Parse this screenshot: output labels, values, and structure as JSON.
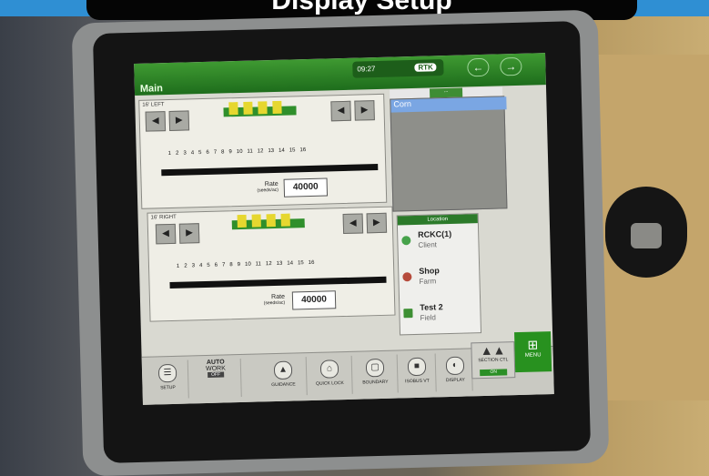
{
  "banner": {
    "title": "Display Setup"
  },
  "topbar": {
    "title": "Main",
    "time": "09:27",
    "rtk": "RTK",
    "back_label": "←",
    "forward_label": "→"
  },
  "panels": {
    "left_top": {
      "tag": "16' LEFT",
      "rate_label": "Rate",
      "rate_unit": "(seeds/ac)",
      "rate_value": "40000"
    },
    "left_bottom": {
      "tag": "16' RIGHT",
      "rate_label": "Rate",
      "rate_unit": "(seeds/ac)",
      "rate_value": "40000"
    },
    "row_numbers": [
      "1",
      "2",
      "3",
      "4",
      "5",
      "6",
      "7",
      "8",
      "9",
      "10",
      "11",
      "12",
      "13",
      "14",
      "15",
      "16"
    ]
  },
  "map": {
    "crop": "Corn"
  },
  "location": {
    "header": "Location",
    "items": [
      {
        "name": "RCKC(1)",
        "type": "Client"
      },
      {
        "name": "Shop",
        "type": "Farm"
      },
      {
        "name": "Test 2",
        "type": "Field"
      }
    ]
  },
  "dock": {
    "setup": "SETUP",
    "auto": "AUTO",
    "work": "WORK",
    "work_state": "OFF",
    "guidance": "GUIDANCE",
    "quick_lock": "QUICK LOCK",
    "boundary": "BOUNDARY",
    "iso": "ISOBUS VT",
    "display": "DISPLAY",
    "section": "SECTION CTL",
    "section_state": "ON",
    "menu": "MENU"
  },
  "colors": {
    "accent_green": "#3f9a32",
    "dark_green": "#1e6d1c",
    "crop_blue": "#7aa6e3"
  }
}
